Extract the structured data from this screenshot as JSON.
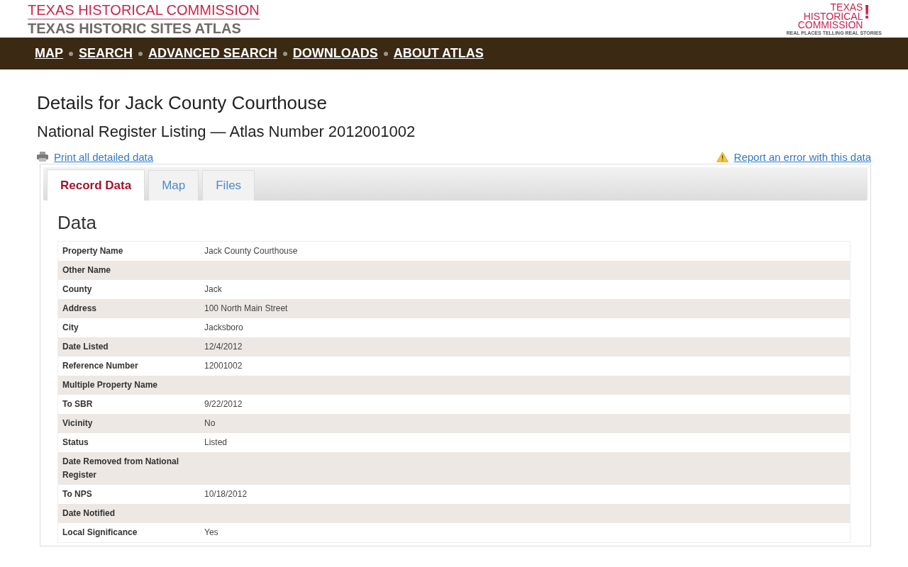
{
  "header": {
    "title": "TEXAS HISTORICAL COMMISSION",
    "subtitle": "TEXAS HISTORIC SITES ATLAS",
    "logo": {
      "lines": [
        "TEXAS",
        "HISTORICAL",
        "COMMISSION"
      ],
      "mark": "!",
      "tagline": "REAL PLACES TELLING REAL STORIES"
    }
  },
  "nav": [
    "MAP",
    "SEARCH",
    "ADVANCED SEARCH",
    "DOWNLOADS",
    "ABOUT ATLAS"
  ],
  "heading": "Details for Jack County Courthouse",
  "subheading": "National Register Listing — Atlas Number 2012001002",
  "print_link": "Print all detailed data",
  "report_link": "Report an error with this data",
  "tabs": [
    {
      "label": "Record Data",
      "selected": true
    },
    {
      "label": "Map",
      "selected": false
    },
    {
      "label": "Files",
      "selected": false
    }
  ],
  "section_title": "Data",
  "rows": [
    {
      "label": "Property Name",
      "value": "Jack County Courthouse"
    },
    {
      "label": "Other Name",
      "value": ""
    },
    {
      "label": "County",
      "value": "Jack"
    },
    {
      "label": "Address",
      "value": "100 North Main Street"
    },
    {
      "label": "City",
      "value": "Jacksboro"
    },
    {
      "label": "Date Listed",
      "value": "12/4/2012"
    },
    {
      "label": "Reference Number",
      "value": "12001002"
    },
    {
      "label": "Multiple Property Name",
      "value": ""
    },
    {
      "label": "To SBR",
      "value": "9/22/2012"
    },
    {
      "label": "Vicinity",
      "value": "No"
    },
    {
      "label": "Status",
      "value": "Listed"
    },
    {
      "label": "Date Removed from National Register",
      "value": ""
    },
    {
      "label": "To NPS",
      "value": "10/18/2012"
    },
    {
      "label": "Date Notified",
      "value": ""
    },
    {
      "label": "Local Significance",
      "value": "Yes"
    }
  ]
}
